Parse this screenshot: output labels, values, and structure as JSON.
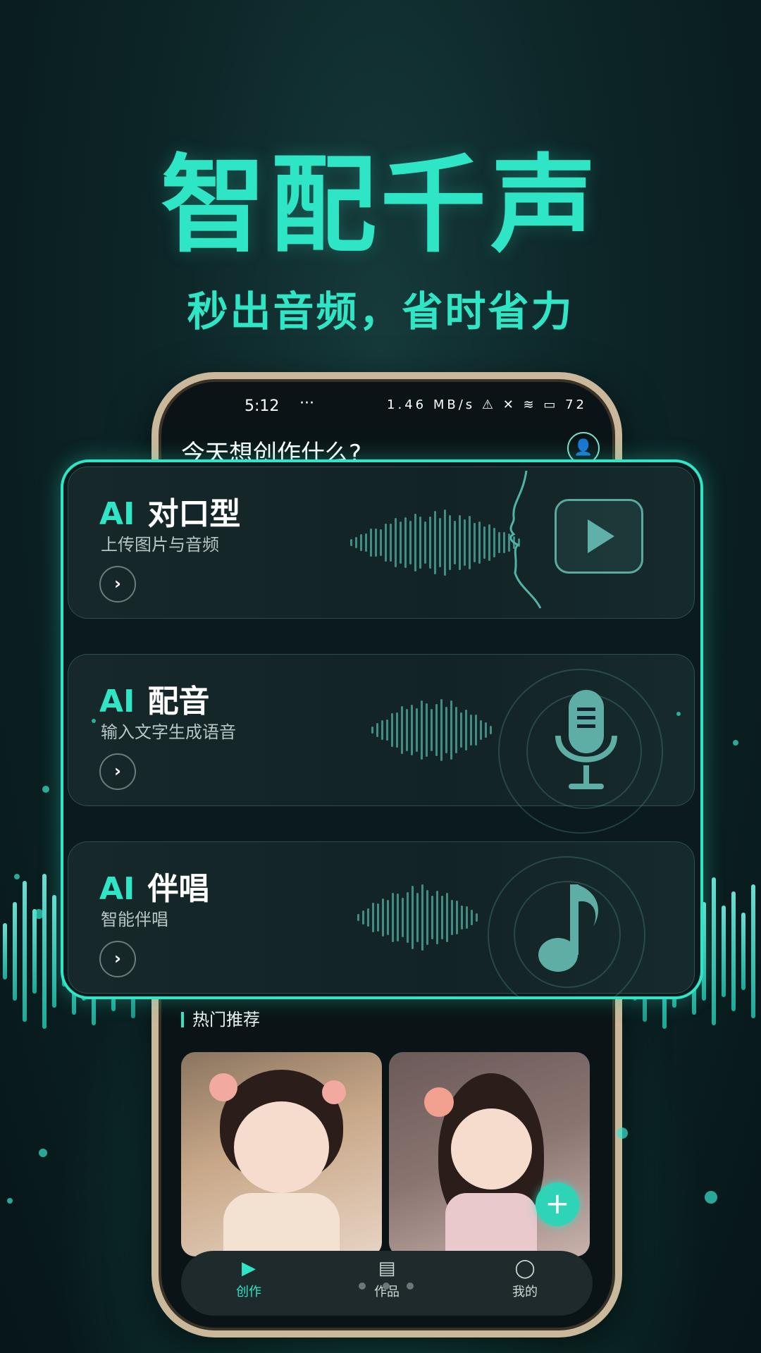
{
  "headline": "智配千声",
  "subheadline": "秒出音频，省时省力",
  "status_bar": {
    "time": "5:12",
    "more": "···",
    "right": "1.46 MB/s  ⚠  ✕  ≋  ▭ 72"
  },
  "app": {
    "greeting": "今天想创作什么?",
    "profile_icon": "user-icon"
  },
  "cards": [
    {
      "ai": "AI",
      "title": "对口型",
      "subtitle": "上传图片与音频",
      "icon": "play-icon"
    },
    {
      "ai": "AI",
      "title": "配音",
      "subtitle": "输入文字生成语音",
      "icon": "microphone-icon"
    },
    {
      "ai": "AI",
      "title": "伴唱",
      "subtitle": "智能伴唱",
      "icon": "music-note-icon"
    }
  ],
  "recommend_title": "热门推荐",
  "tabs": [
    {
      "label": "创作",
      "icon": "play-square-icon",
      "active": true
    },
    {
      "label": "作品",
      "icon": "document-icon",
      "active": false
    },
    {
      "label": "我的",
      "icon": "user-icon",
      "active": false
    }
  ],
  "accent_color": "#2ee6c6"
}
